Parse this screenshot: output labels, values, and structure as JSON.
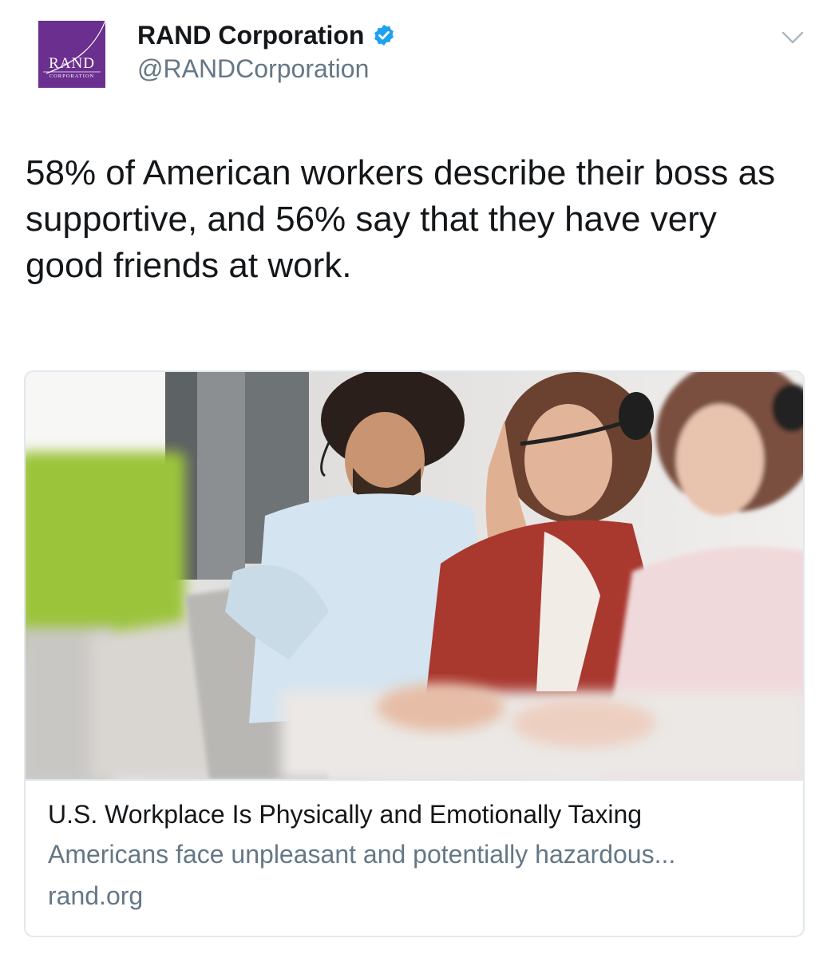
{
  "header": {
    "display_name": "RAND Corporation",
    "handle": "@RANDCorporation",
    "verified": true,
    "avatar": {
      "logo_text": "RAND",
      "logo_subtext": "CORPORATION",
      "background_color": "#6b2f8f"
    },
    "menu_icon": "chevron-down-icon"
  },
  "tweet": {
    "text": "58% of American workers describe their boss as supportive, and 56% say that they have very good friends at work."
  },
  "card": {
    "image_icon": "office-workers-photo",
    "title": "U.S. Workplace Is Physically and Emotionally Taxing",
    "description": "Americans face unpleasant and potentially hazardous...",
    "domain": "rand.org"
  },
  "colors": {
    "primary_text": "#14171a",
    "secondary_text": "#657786",
    "verified_blue": "#1da1f2",
    "card_border": "#e1e8ed"
  }
}
